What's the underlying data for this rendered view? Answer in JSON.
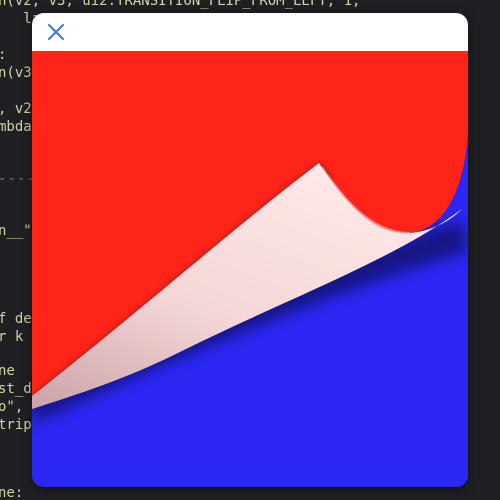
{
  "background_code": [
    "n(v2, v3, ui2.TRANSITION_FLIP_FROM_LEFT, 1,",
    "   la",
    ":",
    "n(v3",
    ", v2",
    "mbda",
    "----",
    "n__\"",
    "f de",
    "r k",
    "ne",
    "st_d",
    "o\",",
    "trip",
    "ne:"
  ],
  "modal": {
    "close_icon": "close-x-icon",
    "colors": {
      "header": "#ffffff",
      "accent": "#3a78d8",
      "front_view": "#ff2318",
      "back_view": "#2a27f2",
      "page_underside": "#fbdada"
    }
  }
}
